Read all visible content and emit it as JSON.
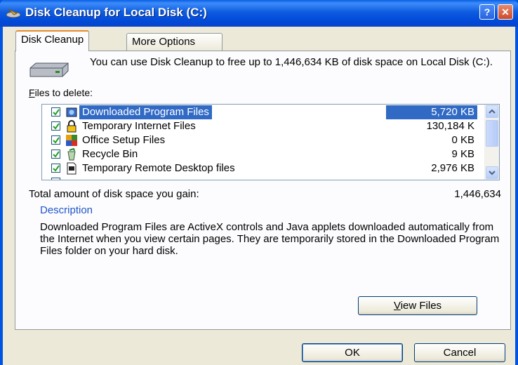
{
  "window": {
    "title": "Disk Cleanup for Local Disk (C:)",
    "help_label": "?",
    "close_label": "✕"
  },
  "tabs": [
    {
      "label": "Disk Cleanup"
    },
    {
      "label": "More Options"
    }
  ],
  "intro_text": "You can use Disk Cleanup to free up to 1,446,634 KB of disk space on Local Disk (C:).",
  "files_label_access": "F",
  "files_label_rest": "iles to delete:",
  "files": [
    {
      "name": "Downloaded Program Files",
      "size": "5,720 KB",
      "checked": true,
      "selected": true,
      "icon": "downloaded-programs-icon"
    },
    {
      "name": "Temporary Internet Files",
      "size": "130,184 K",
      "checked": true,
      "selected": false,
      "icon": "lock-icon"
    },
    {
      "name": "Office Setup Files",
      "size": "0 KB",
      "checked": true,
      "selected": false,
      "icon": "office-icon"
    },
    {
      "name": "Recycle Bin",
      "size": "9 KB",
      "checked": true,
      "selected": false,
      "icon": "recycle-bin-icon"
    },
    {
      "name": "Temporary Remote Desktop files",
      "size": "2,976 KB",
      "checked": true,
      "selected": false,
      "icon": "remote-desktop-icon"
    }
  ],
  "total_label": "Total amount of disk space you gain:",
  "total_value": "1,446,634",
  "description_heading": "Description",
  "description_text": "Downloaded Program Files are ActiveX controls and Java applets downloaded automatically from the Internet when you view certain pages. They are temporarily stored in the Downloaded Program Files folder on your hard disk.",
  "buttons": {
    "view_files_access": "V",
    "view_files_rest": "iew Files",
    "ok": "OK",
    "cancel": "Cancel"
  },
  "colors": {
    "selection": "#316ac5",
    "titlebar": "#0054e3",
    "dialog_bg": "#ece9d8"
  }
}
